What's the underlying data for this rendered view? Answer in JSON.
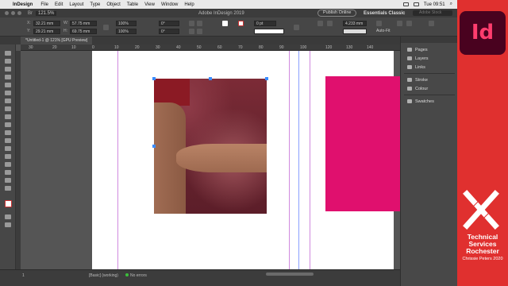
{
  "menubar": {
    "app": "InDesign",
    "items": [
      "File",
      "Edit",
      "Layout",
      "Type",
      "Object",
      "Table",
      "View",
      "Window",
      "Help"
    ],
    "clock": "Tue 09:51"
  },
  "appbar": {
    "zoom": "121.5%",
    "title": "Adobe InDesign 2019",
    "publish_label": "Publish Online",
    "workspace": "Essentials Classic",
    "search_placeholder": "Adobe Stock"
  },
  "control": {
    "x": "32.21 mm",
    "y": "29.21 mm",
    "w": "57.75 mm",
    "h": "69.75 mm",
    "scale_x": "100%",
    "scale_y": "100%",
    "angle": "0°",
    "shear": "0°",
    "stroke_weight": "0 pt",
    "gap": "4.233 mm",
    "autofit": "Auto-Fit"
  },
  "tab": {
    "label": "*Untitled-1 @ 121% [GPU Preview]"
  },
  "ruler": {
    "ticks": [
      "30",
      "20",
      "10",
      "0",
      "10",
      "20",
      "30",
      "40",
      "50",
      "60",
      "70",
      "80",
      "90",
      "100",
      "120",
      "130",
      "140"
    ]
  },
  "status": {
    "page": "1",
    "style": "[Basic] (working)",
    "errors": "No errors"
  },
  "panels": {
    "items": [
      "Pages",
      "Layers",
      "Links",
      "Stroke",
      "Colour",
      "Swatches"
    ]
  },
  "brand": {
    "logo": "Id",
    "line1": "Technical Services Rochester",
    "line2": "Chrissie Peters 2020"
  },
  "colors": {
    "magenta": "#e0106e",
    "brand_red": "#e0302f",
    "logo_bg": "#49021f"
  }
}
